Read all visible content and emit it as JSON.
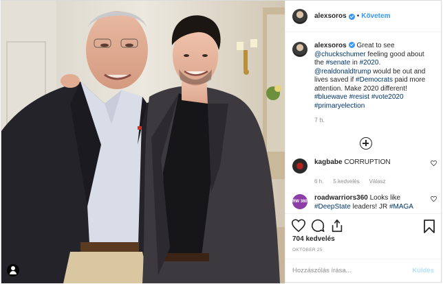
{
  "post": {
    "username": "alexsoros",
    "follow_label": "Követem",
    "dot": "•",
    "caption": {
      "username": "alexsoros",
      "parts": [
        {
          "t": " Great to see ",
          "link": false
        },
        {
          "t": "@chuckschumer",
          "link": true
        },
        {
          "t": " feeling good about the ",
          "link": false
        },
        {
          "t": "#senate",
          "link": true
        },
        {
          "t": " in ",
          "link": false
        },
        {
          "t": "#2020",
          "link": true
        },
        {
          "t": ". ",
          "link": false
        },
        {
          "t": "@realdonaldtrump",
          "link": true
        },
        {
          "t": " would be out and lives saved if ",
          "link": false
        },
        {
          "t": "#Democrats",
          "link": true
        },
        {
          "t": " paid more attention. Make 2020 different! ",
          "link": false
        },
        {
          "t": "#bluewave",
          "link": true
        },
        {
          "t": " ",
          "link": false
        },
        {
          "t": "#resist",
          "link": true
        },
        {
          "t": " ",
          "link": false
        },
        {
          "t": "#vote2020",
          "link": true
        },
        {
          "t": " ",
          "link": false
        },
        {
          "t": "#primaryelection",
          "link": true
        }
      ],
      "time": "7 h."
    },
    "comments": [
      {
        "username": "kagbabe",
        "text": "CORRUPTION",
        "time": "6 h.",
        "likes": "5 kedvelés",
        "reply": "Válasz"
      },
      {
        "username": "roadwarriors360",
        "avatar_text": "RW 360",
        "text_plain": "Looks like",
        "hashtag": "#DeepState",
        "text_mid": "leaders! JR",
        "hashtag2": "#MAGA"
      }
    ],
    "likes": "704 kedvelés",
    "date": "Október 25",
    "add_comment_placeholder": "Hozzászólás írása...",
    "post_button": "Küldés",
    "colors": {
      "link": "#003569",
      "accent": "#3897f0",
      "muted": "#8e8e8e"
    }
  }
}
